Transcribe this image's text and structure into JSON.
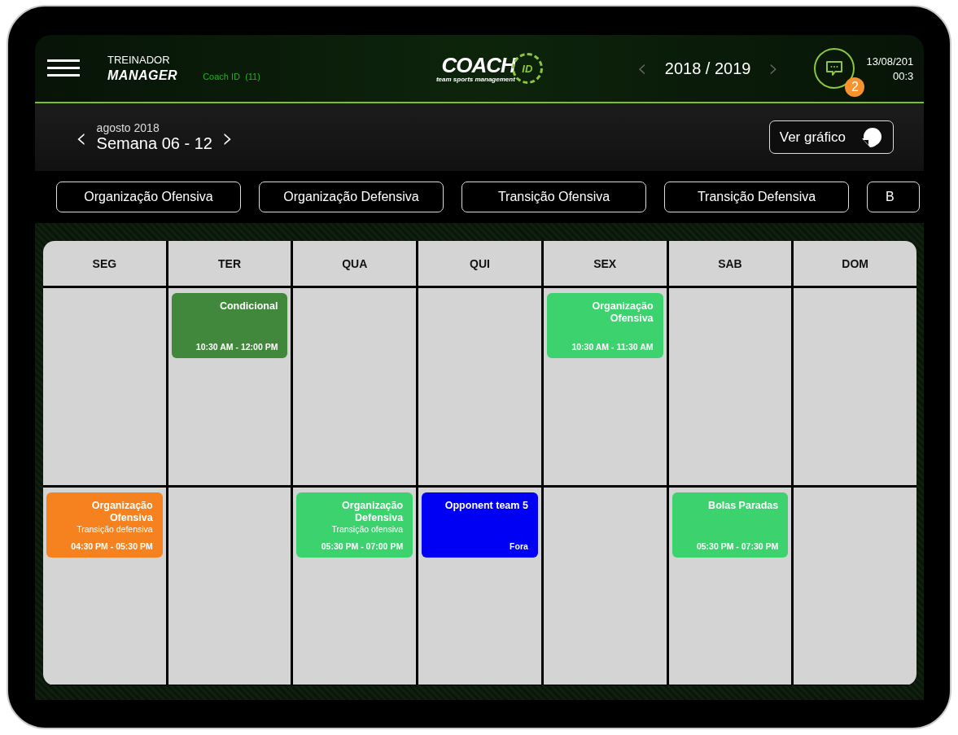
{
  "header": {
    "role": "TREINADOR",
    "app_name": "MANAGER",
    "coach_id": "Coach ID  (11)",
    "logo": {
      "word": "COACH",
      "badge": "ID",
      "tagline": "team sports management"
    },
    "season": {
      "prev": "‹",
      "label": "2018 / 2019",
      "next": "›"
    },
    "messages": {
      "badge": "2"
    },
    "date": "13/08/201",
    "time": "00:3"
  },
  "week": {
    "prev": "‹",
    "month": "agosto 2018",
    "label": "Semana 06 - 12",
    "next": "›",
    "chart_button": "Ver gráfico"
  },
  "filters": [
    {
      "label": "Organização Ofensiva"
    },
    {
      "label": "Organização Defensiva"
    },
    {
      "label": "Transição Ofensiva"
    },
    {
      "label": "Transição Defensiva"
    },
    {
      "label": "B"
    }
  ],
  "calendar": {
    "days": [
      "SEG",
      "TER",
      "QUA",
      "QUI",
      "SEX",
      "SAB",
      "DOM"
    ],
    "rows": [
      [
        null,
        {
          "title": "Condicional",
          "time": "10:30 AM - 12:00 PM",
          "color": "#41873c"
        },
        null,
        null,
        {
          "title": "Organização Ofensiva",
          "time": "10:30 AM - 11:30 AM",
          "color": "#3cd26e"
        },
        null,
        null
      ],
      [
        {
          "title": "Organização Ofensiva",
          "subtitle": "Transição defensiva",
          "time": "04:30 PM - 05:30 PM",
          "color": "#f5821e"
        },
        null,
        {
          "title": "Organização Defensiva",
          "subtitle": "Transição ofensiva",
          "time": "05:30 PM - 07:00 PM",
          "color": "#3cd26e"
        },
        {
          "title": "Opponent team 5",
          "time": "Fora",
          "color": "#0000f5"
        },
        null,
        {
          "title": "Bolas Paradas",
          "time": "05:30 PM - 07:30 PM",
          "color": "#3cd26e"
        },
        null
      ]
    ]
  }
}
